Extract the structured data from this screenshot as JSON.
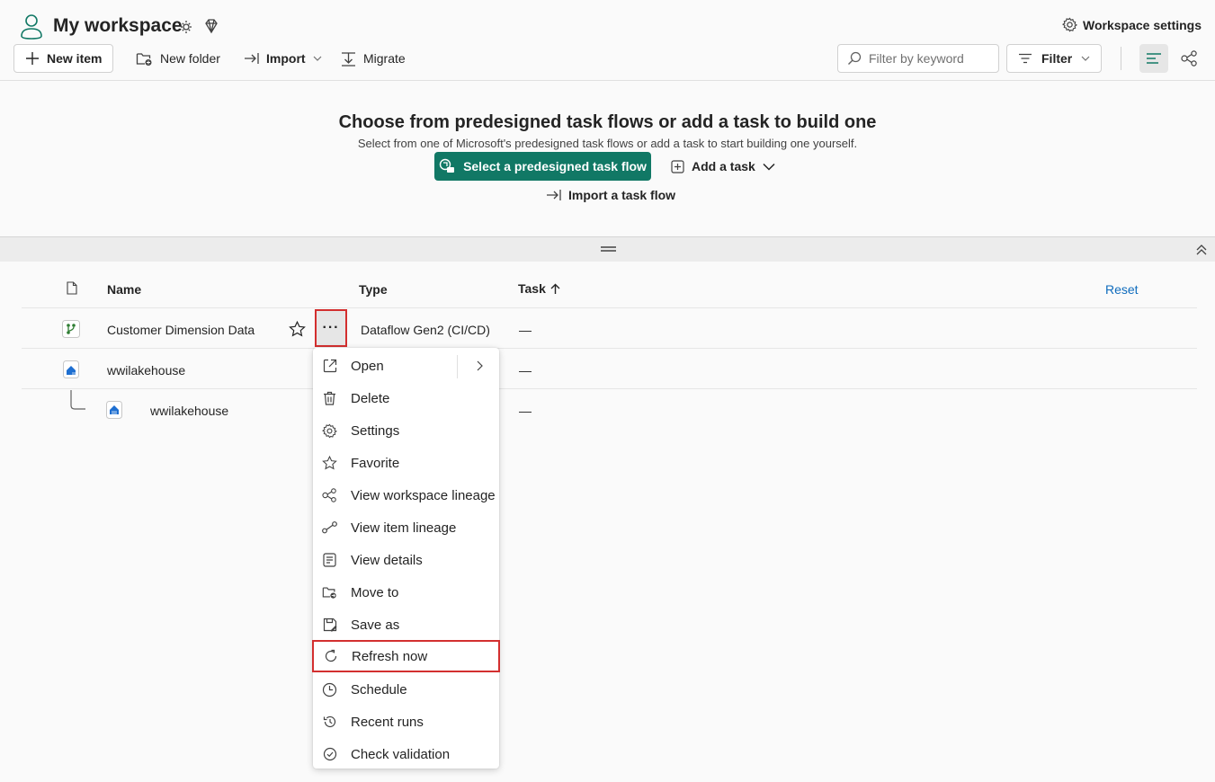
{
  "header": {
    "title": "My workspace",
    "workspace_settings": "Workspace settings",
    "new_item": "New item",
    "new_folder": "New folder",
    "import": "Import",
    "migrate": "Migrate",
    "filter_placeholder": "Filter by keyword",
    "filter": "Filter"
  },
  "taskflow": {
    "title": "Choose from predesigned task flows or add a task to build one",
    "subtitle": "Select from one of Microsoft's predesigned task flows or add a task to start building one yourself.",
    "primary": "Select a predesigned task flow",
    "add_task": "Add a task",
    "import_flow": "Import a task flow"
  },
  "table": {
    "columns": {
      "name": "Name",
      "type": "Type",
      "task": "Task"
    },
    "reset": "Reset",
    "rows": [
      {
        "name": "Customer Dimension Data",
        "type": "Dataflow Gen2 (CI/CD)",
        "task": "—"
      },
      {
        "name": "wwilakehouse",
        "type": "",
        "task": "—"
      },
      {
        "name": "wwilakehouse",
        "type": "",
        "task": "—"
      }
    ],
    "more": "···"
  },
  "menu": {
    "items": [
      {
        "label": "Open",
        "icon": "open-external-icon"
      },
      {
        "label": "Delete",
        "icon": "trash-icon"
      },
      {
        "label": "Settings",
        "icon": "gear-icon"
      },
      {
        "label": "Favorite",
        "icon": "star-icon"
      },
      {
        "label": "View workspace lineage",
        "icon": "lineage-icon"
      },
      {
        "label": "View item lineage",
        "icon": "item-lineage-icon"
      },
      {
        "label": "View details",
        "icon": "details-icon"
      },
      {
        "label": "Move to",
        "icon": "folder-move-icon"
      },
      {
        "label": "Save as",
        "icon": "save-icon"
      },
      {
        "label": "Refresh now",
        "icon": "refresh-icon"
      },
      {
        "label": "Schedule",
        "icon": "clock-icon"
      },
      {
        "label": "Recent runs",
        "icon": "history-icon"
      },
      {
        "label": "Check validation",
        "icon": "check-circle-icon"
      }
    ]
  },
  "colors": {
    "accent": "#117865",
    "highlight": "#d32f2f",
    "link": "#0f6cbd"
  }
}
